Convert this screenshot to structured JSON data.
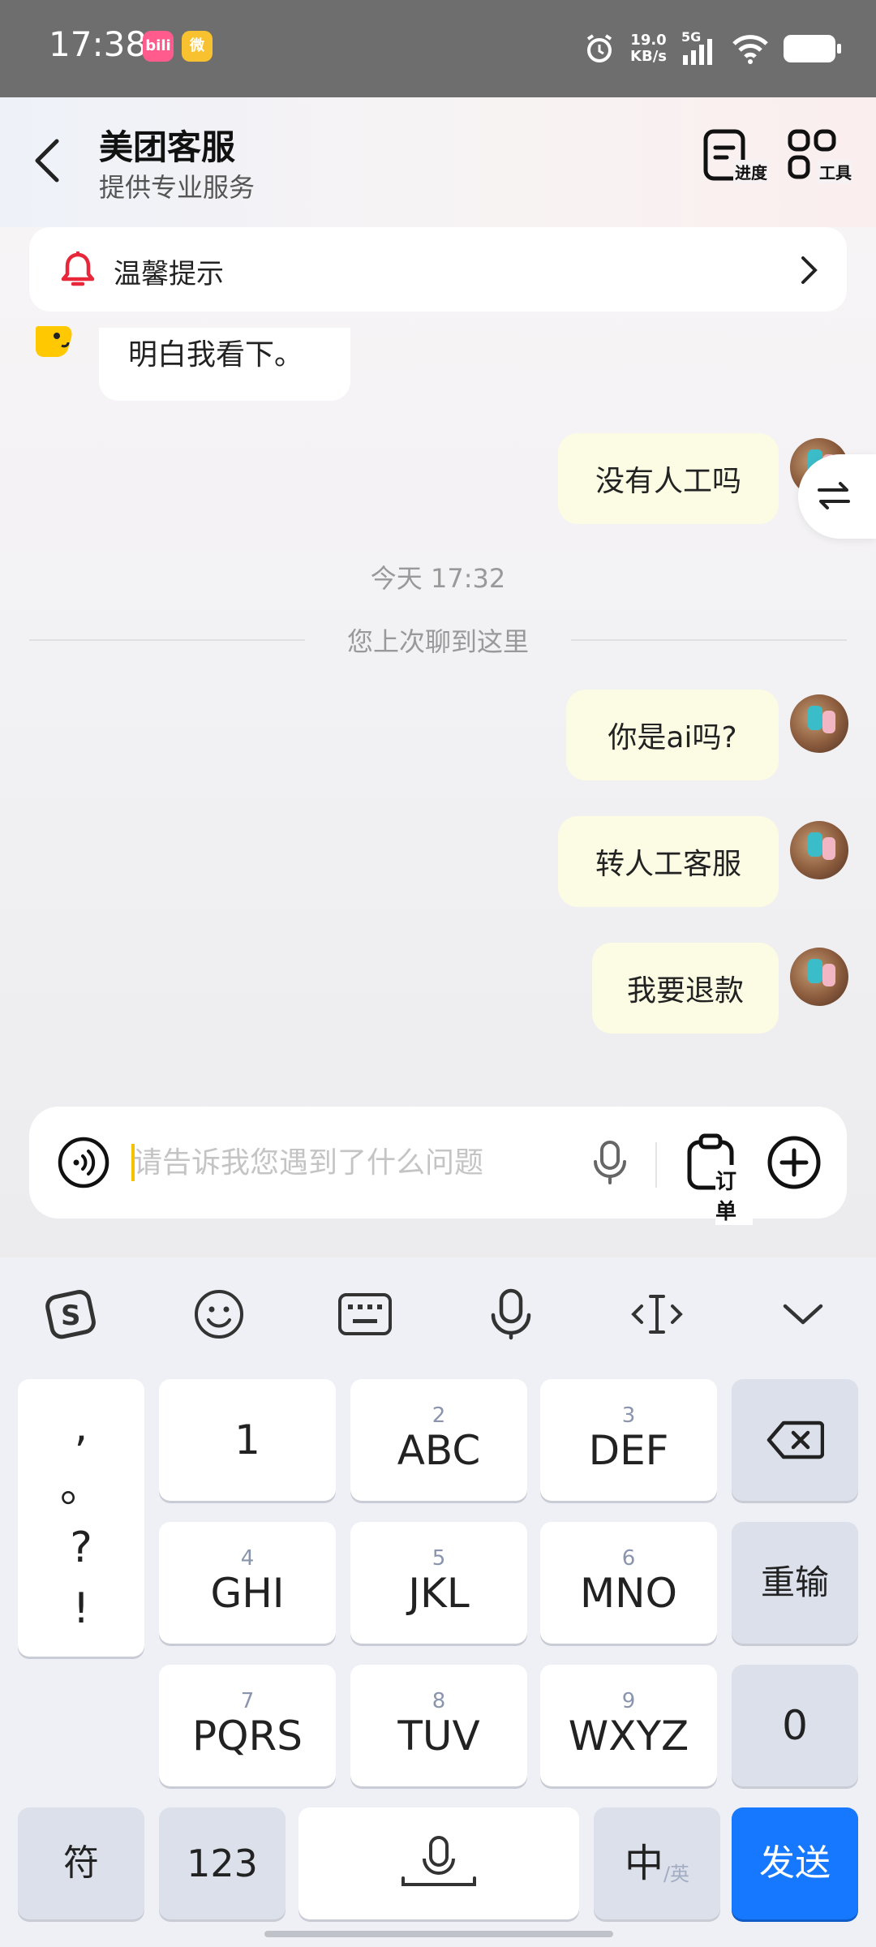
{
  "status_bar": {
    "time": "17:38",
    "app_icons": [
      "bilibili-icon",
      "weibo-icon"
    ],
    "net_speed_value": "19.0",
    "net_speed_unit": "KB/s",
    "signal_label": "5G"
  },
  "header": {
    "title": "美团客服",
    "subtitle": "提供专业服务",
    "progress_label": "进度",
    "tools_label": "工具"
  },
  "notice": {
    "text": "温馨提示"
  },
  "messages": {
    "bot_partial": "明白我看下。",
    "user_1": "没有人工吗",
    "time_label": "今天 17:32",
    "divider_text": "您上次聊到这里",
    "user_2": "你是ai吗?",
    "user_3": "转人工客服",
    "user_4": "我要退款"
  },
  "input": {
    "placeholder": "请告诉我您遇到了什么问题",
    "value": "",
    "order_label": "订单"
  },
  "keyboard": {
    "punct": [
      ",",
      "。",
      "?",
      "!"
    ],
    "row1": [
      {
        "num": "",
        "main": "1"
      },
      {
        "num": "2",
        "main": "ABC"
      },
      {
        "num": "3",
        "main": "DEF"
      }
    ],
    "row2": [
      {
        "num": "4",
        "main": "GHI"
      },
      {
        "num": "5",
        "main": "JKL"
      },
      {
        "num": "6",
        "main": "MNO"
      }
    ],
    "row3": [
      {
        "num": "7",
        "main": "PQRS"
      },
      {
        "num": "8",
        "main": "TUV"
      },
      {
        "num": "9",
        "main": "WXYZ"
      }
    ],
    "reenter": "重输",
    "zero": "0",
    "symbols": "符",
    "numbers": "123",
    "lang_main": "中",
    "lang_sub": "/英",
    "send": "发送"
  },
  "colors": {
    "accent": "#1677ff",
    "user_bubble": "#fcfbe3",
    "status_bar": "#6e6e6e"
  }
}
